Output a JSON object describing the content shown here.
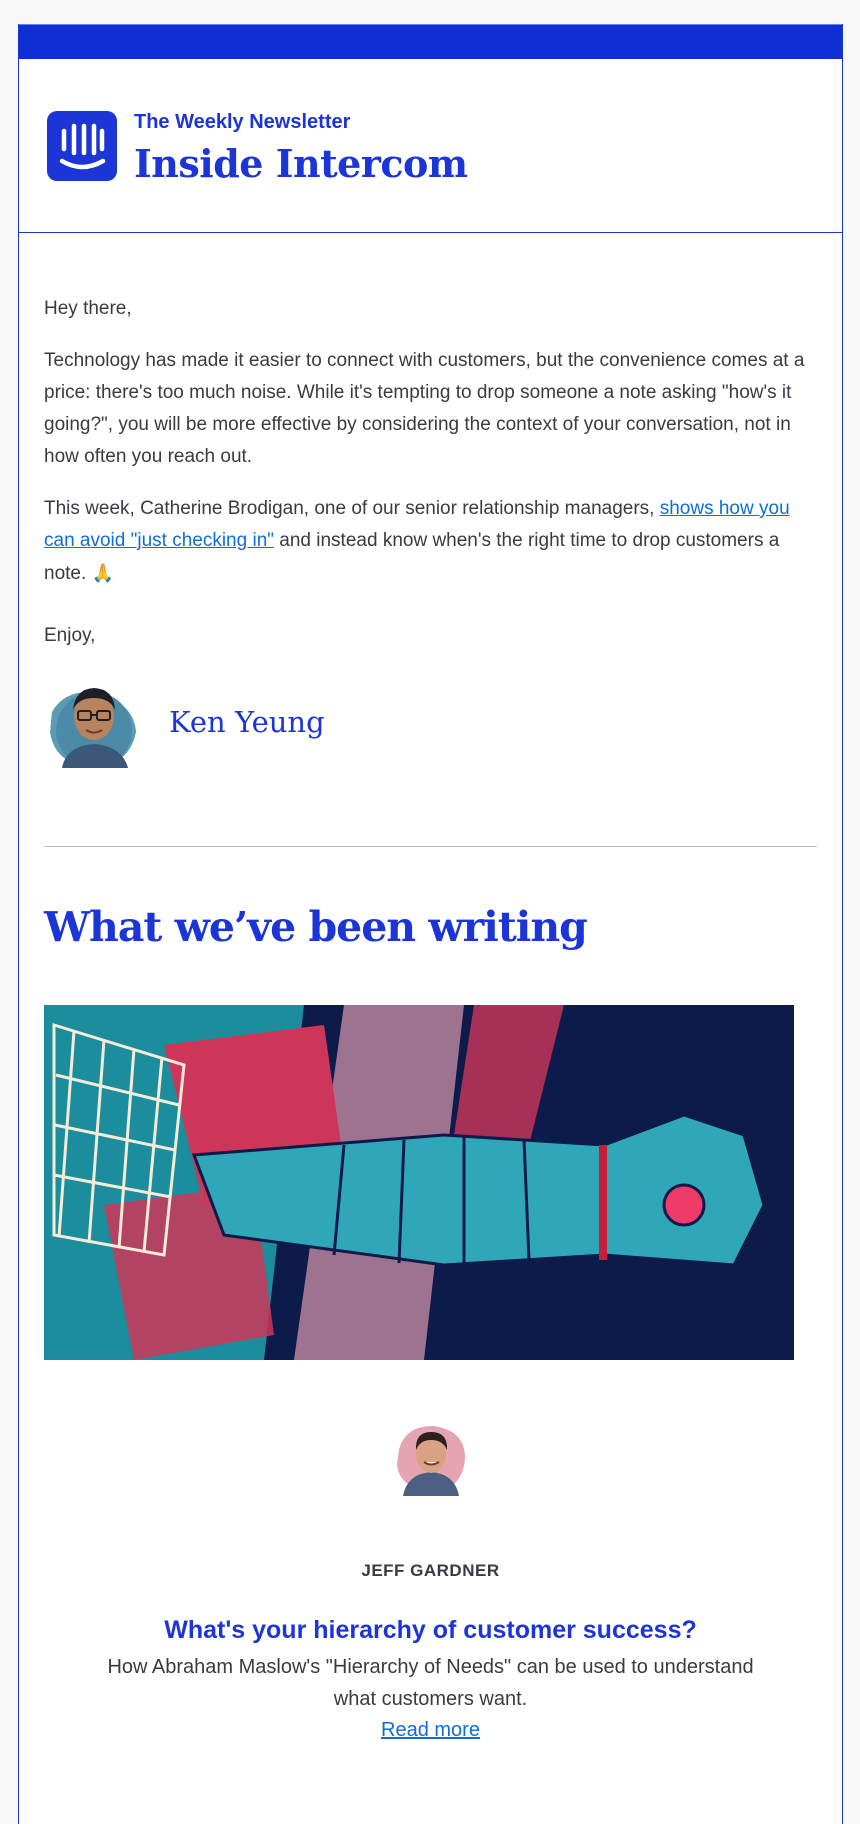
{
  "masthead": {
    "subtitle": "The Weekly Newsletter",
    "title": "Inside Intercom"
  },
  "intro": {
    "greeting": "Hey there,",
    "paragraph1": "Technology has made it easier to connect with customers, but the convenience comes at a price: there's too much noise. While it's tempting to drop someone a note asking \"how's it going?\", you will be more effective by considering the context of your conversation, not in how often you reach out.",
    "paragraph2_before": "This week, Catherine Brodigan, one of our senior relationship managers, ",
    "paragraph2_link": "shows how you can avoid \"just checking in\"",
    "paragraph2_after": " and instead know when's the right time to drop customers a note. ",
    "paragraph2_emoji": "🙏",
    "signoff": "Enjoy,",
    "signature_name": "Ken Yeung"
  },
  "section": {
    "title": "What we’ve been writing"
  },
  "article": {
    "author": "JEFF GARDNER",
    "title": "What's your hierarchy of customer success?",
    "description": "How Abraham Maslow's \"Hierarchy of Needs\" can be used to understand what customers want.",
    "read_more": "Read more"
  },
  "colors": {
    "brand": "#1c35d6",
    "link": "#0d6ed8",
    "body_text": "#3a3a44"
  }
}
